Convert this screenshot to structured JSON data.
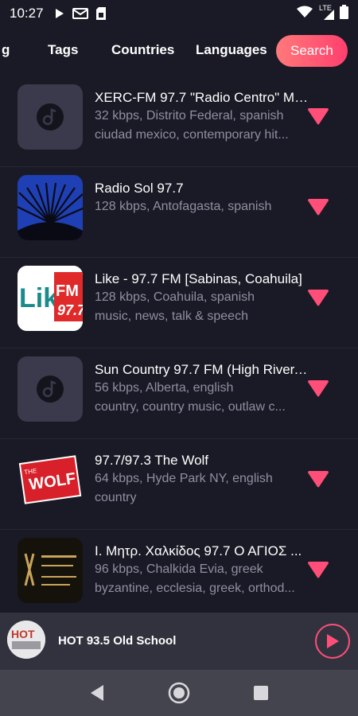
{
  "status_bar": {
    "time": "10:27",
    "icons": [
      "play-icon",
      "mail-icon",
      "sim-icon",
      "wifi-icon",
      "lte-signal-icon",
      "battery-icon"
    ],
    "network": "LTE"
  },
  "tabs": [
    {
      "label": "g",
      "active": false
    },
    {
      "label": "Tags",
      "active": false
    },
    {
      "label": "Countries",
      "active": false
    },
    {
      "label": "Languages",
      "active": false
    },
    {
      "label": "Search",
      "active": true
    }
  ],
  "stations": [
    {
      "title": "XERC-FM 97.7 \"Radio Centro\" Me...",
      "line2": "32 kbps, Distrito Federal, spanish",
      "line3": "ciudad mexico, contemporary hit...",
      "thumb": "placeholder"
    },
    {
      "title": "Radio Sol 97.7",
      "line2": "128 kbps, Antofagasta, spanish",
      "line3": "",
      "thumb": "radio-sol-logo"
    },
    {
      "title": "Like - 97.7 FM [Sabinas, Coahuila]",
      "line2": "128 kbps, Coahuila, spanish",
      "line3": "music, news, talk & speech",
      "thumb": "like-fm-logo",
      "logo_text": "Like FM 97.7"
    },
    {
      "title": "Sun Country 97.7 FM (High River, ...",
      "line2": "56 kbps, Alberta, english",
      "line3": "country, country music, outlaw c...",
      "thumb": "placeholder"
    },
    {
      "title": "97.7/97.3 The Wolf",
      "line2": "64 kbps, Hyde Park NY, english",
      "line3": "country",
      "thumb": "the-wolf-logo",
      "logo_text": "THE WOLF"
    },
    {
      "title": "Ι. Μητρ. Χαλκίδος 97.7 Ο ΑΓΙΟΣ ...",
      "line2": "96 kbps, Chalkida Evia, greek",
      "line3": "byzantine, ecclesia, greek, orthod...",
      "thumb": "greek-church-logo"
    }
  ],
  "player": {
    "title": "HOT 93.5 Old School",
    "logo_text": "HOT",
    "accent": "#ff4f78"
  },
  "colors": {
    "background": "#1a1a26",
    "accent": "#ff4f78",
    "secondary_text": "#8f8fa3"
  }
}
